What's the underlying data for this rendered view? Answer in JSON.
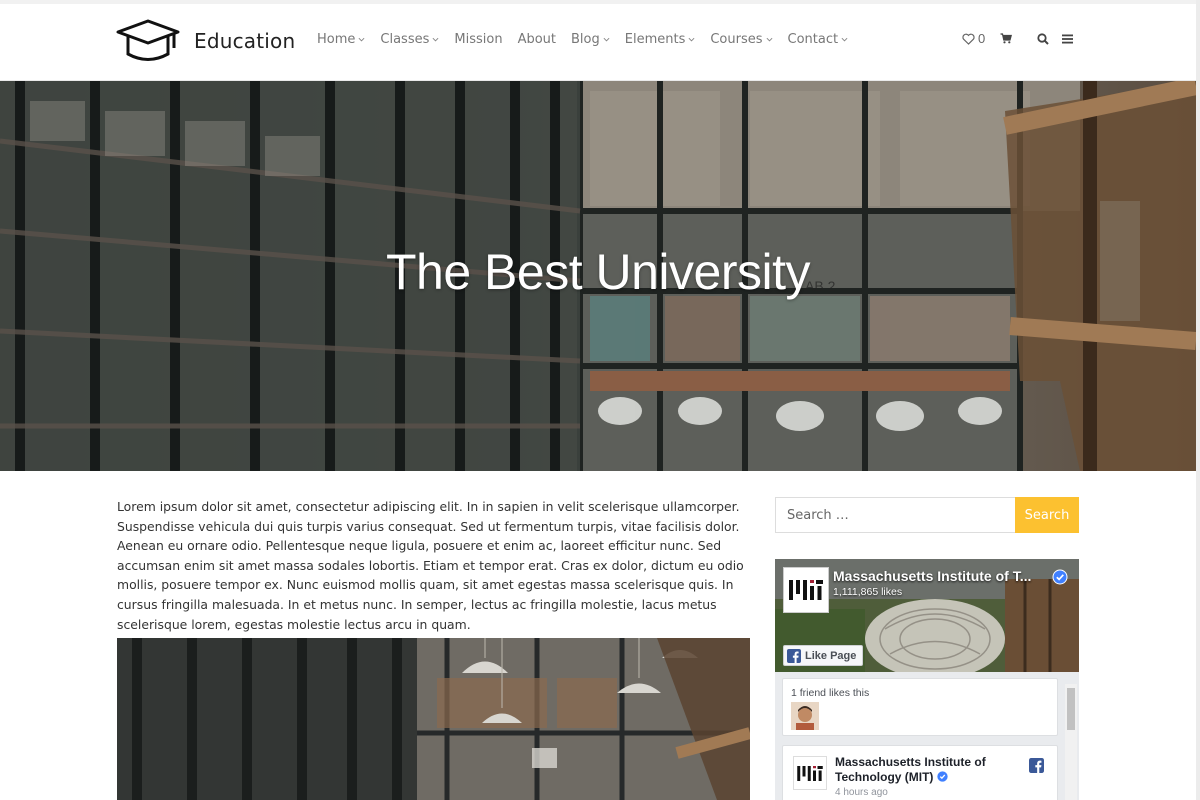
{
  "header": {
    "brand_name": "Education",
    "nav": [
      {
        "label": "Home",
        "has_dropdown": true
      },
      {
        "label": "Classes",
        "has_dropdown": true
      },
      {
        "label": "Mission",
        "has_dropdown": false
      },
      {
        "label": "About",
        "has_dropdown": false
      },
      {
        "label": "Blog",
        "has_dropdown": true
      },
      {
        "label": "Elements",
        "has_dropdown": true
      },
      {
        "label": "Courses",
        "has_dropdown": true
      },
      {
        "label": "Contact",
        "has_dropdown": true
      }
    ],
    "wishlist_count": "0",
    "icons": [
      "heart-icon",
      "cart-icon",
      "search-icon",
      "menu-icon"
    ]
  },
  "hero": {
    "title": "The Best University"
  },
  "article": {
    "paragraph": "Lorem ipsum dolor sit amet, consectetur adipiscing elit. In in sapien in velit scelerisque ullamcorper. Suspendisse vehicula dui quis turpis varius consequat. Sed ut fermentum turpis, vitae facilisis dolor. Aenean eu ornare odio. Pellentesque neque ligula, posuere et enim ac, laoreet efficitur nunc. Sed accumsan enim sit amet massa sodales lobortis. Etiam et tempor erat. Cras ex dolor, dictum eu odio mollis, posuere tempor ex. Nunc euismod mollis quam, sit amet egestas massa scelerisque quis. In cursus fringilla malesuada. In et metus nunc. In semper, lectus ac fringilla molestie, lacus metus scelerisque lorem, egestas molestie lectus arcu in quam."
  },
  "sidebar": {
    "search": {
      "placeholder": "Search …",
      "button_label": "Search"
    },
    "facebook": {
      "page_name": "Massachusetts Institute of T...",
      "likes": "1,111,865 likes",
      "like_button": "Like Page",
      "friends_text": "1 friend likes this",
      "post_author_line1": "Massachusetts Institute of",
      "post_author_line2": "Technology (MIT)",
      "post_time": "4 hours ago"
    }
  },
  "colors": {
    "accent": "#fcc130",
    "facebook_blue": "#3b5998",
    "verified_blue": "#4080ff"
  }
}
